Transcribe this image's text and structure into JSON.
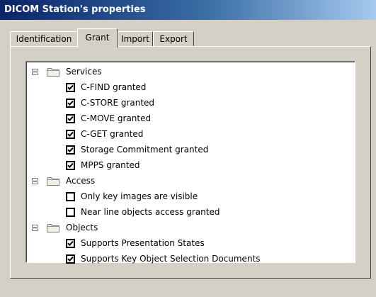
{
  "window": {
    "title": "DICOM Station's properties"
  },
  "tabs": [
    {
      "label": "Identification",
      "active": false
    },
    {
      "label": "Grant",
      "active": true
    },
    {
      "label": "Import",
      "active": false
    },
    {
      "label": "Export",
      "active": false
    }
  ],
  "tree": {
    "groups": [
      {
        "label": "Services",
        "expanded": true,
        "items": [
          {
            "label": "C-FIND granted",
            "checked": true
          },
          {
            "label": "C-STORE granted",
            "checked": true
          },
          {
            "label": "C-MOVE granted",
            "checked": true
          },
          {
            "label": "C-GET granted",
            "checked": true
          },
          {
            "label": "Storage Commitment granted",
            "checked": true
          },
          {
            "label": "MPPS granted",
            "checked": true
          }
        ]
      },
      {
        "label": "Access",
        "expanded": true,
        "items": [
          {
            "label": "Only key images are visible",
            "checked": false
          },
          {
            "label": "Near line objects access granted",
            "checked": false
          }
        ]
      },
      {
        "label": "Objects",
        "expanded": true,
        "items": [
          {
            "label": "Supports Presentation States",
            "checked": true
          },
          {
            "label": "Supports Key Object Selection Documents",
            "checked": true
          }
        ]
      }
    ]
  }
}
